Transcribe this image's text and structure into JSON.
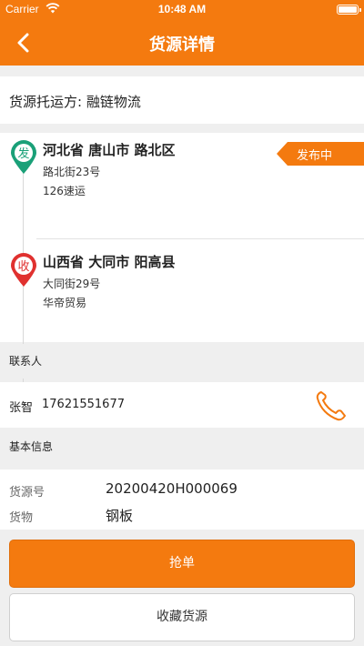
{
  "statusbar": {
    "carrier": "Carrier",
    "time": "10:48 AM"
  },
  "navbar": {
    "title": "货源详情"
  },
  "shipper": {
    "label": "货源托运方: 融链物流"
  },
  "route": {
    "status": "发布中",
    "from": {
      "marker": "发",
      "region": "河北省 唐山市 路北区",
      "street": "路北街23号",
      "company": "126速运",
      "color": "#1aa078"
    },
    "to": {
      "marker": "收",
      "region": "山西省 大同市 阳高县",
      "street": "大同街29号",
      "company": "华帝贸易",
      "color": "#e0312f"
    }
  },
  "contact": {
    "section": "联系人",
    "name": "张智",
    "phone": "17621551677"
  },
  "basic": {
    "section": "基本信息",
    "rows": [
      {
        "label": "货源号",
        "value": "20200420H000069"
      },
      {
        "label": "货物",
        "value": "钢板"
      }
    ]
  },
  "actions": {
    "grab": "抢单",
    "favorite": "收藏货源"
  },
  "colors": {
    "accent": "#f47a0f"
  }
}
